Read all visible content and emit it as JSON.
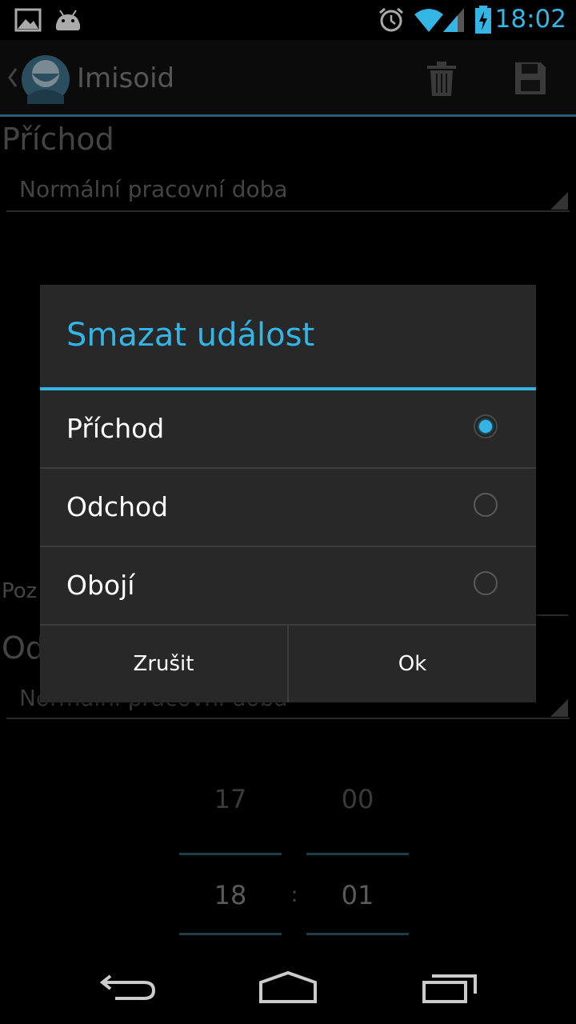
{
  "status_bar": {
    "time": "18:02",
    "icons": [
      "picture-icon",
      "android-icon",
      "alarm-icon",
      "wifi-icon",
      "signal-icon",
      "battery-charging-icon"
    ]
  },
  "action_bar": {
    "title": "Imisoid",
    "back_icon": "chevron-left-icon",
    "avatar_icon": "avatar-icon",
    "actions": [
      "trash-icon",
      "save-icon"
    ]
  },
  "background": {
    "section1_title": "Příchod",
    "section1_spinner": "Normální pracovní doba",
    "note_label": "Poz",
    "section2_title": "Od",
    "section2_spinner": "Normální pracovní doba",
    "time_picker": {
      "hour_prev": "17",
      "minute_prev": "00",
      "hour": "18",
      "minute": "01",
      "separator": ":"
    }
  },
  "dialog": {
    "title": "Smazat událost",
    "options": [
      {
        "label": "Příchod",
        "selected": true
      },
      {
        "label": "Odchod",
        "selected": false
      },
      {
        "label": "Obojí",
        "selected": false
      }
    ],
    "cancel_label": "Zrušit",
    "ok_label": "Ok"
  },
  "nav_bar": {
    "buttons": [
      "back-icon",
      "home-icon",
      "recents-icon"
    ]
  },
  "colors": {
    "accent": "#33b5e5",
    "dialog_bg": "#282828"
  }
}
